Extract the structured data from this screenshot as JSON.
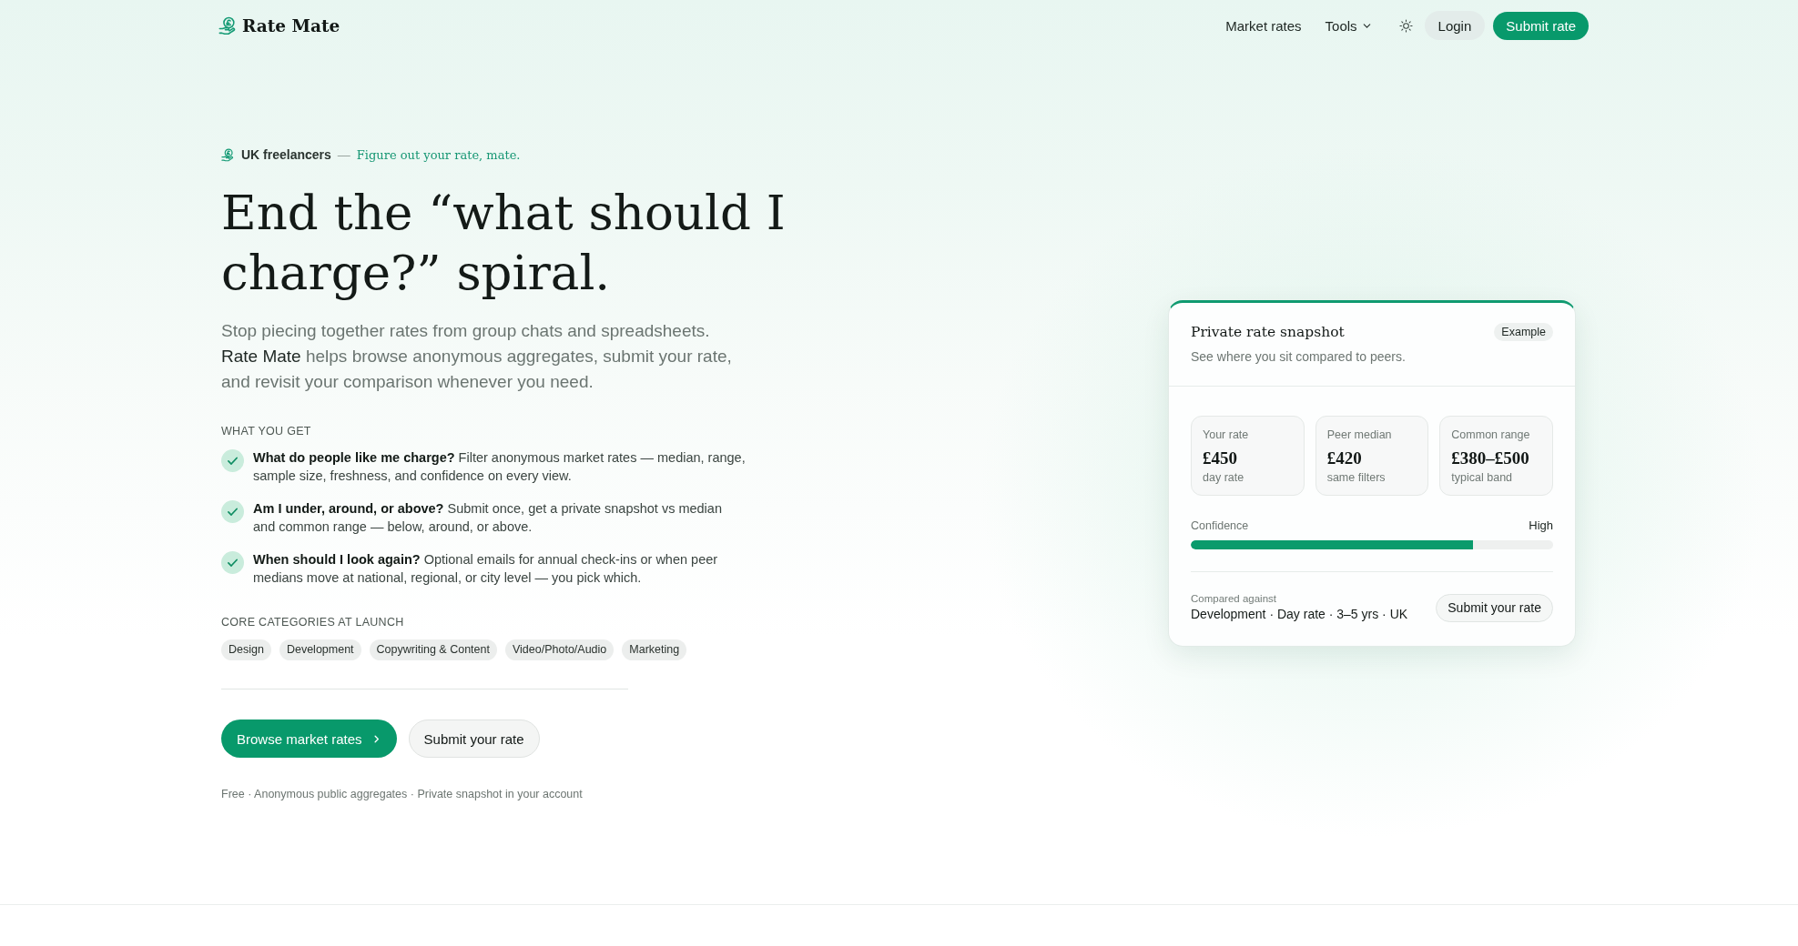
{
  "header": {
    "logo": "Rate Mate",
    "nav": [
      {
        "label": "Market rates",
        "kind": "link"
      },
      {
        "label": "Tools",
        "kind": "dropdown"
      }
    ],
    "login": "Login",
    "cta": "Submit rate"
  },
  "hero": {
    "eyebrow": {
      "audience": "UK freelancers",
      "separator": "—",
      "tagline": "Figure out your rate, mate."
    },
    "headline": "End the “what should I charge?” spiral.",
    "intro": "Stop piecing together rates from group chats and spreadsheets. **Rate Mate** helps browse anonymous aggregates, submit your rate, and revisit your comparison whenever you need.",
    "benefits": {
      "heading": "WHAT YOU GET",
      "items": [
        "**What do people like me charge?** Filter anonymous market rates — median, range, sample size, freshness, and confidence on every view.",
        "**Am I under, around, or above?** Submit once, get a private snapshot vs median and common range — below, around, or above.",
        "**When should I look again?** Optional emails for annual check-ins or when peer medians move at national, regional, or city level — you pick which."
      ]
    },
    "categories": {
      "heading": "CORE CATEGORIES AT LAUNCH",
      "items": [
        "Design",
        "Development",
        "Copywriting & Content",
        "Video/Photo/Audio",
        "Marketing"
      ]
    },
    "actions": [
      {
        "label": "Browse market rates",
        "kind": "primary"
      },
      {
        "label": "Submit your rate",
        "kind": "secondary"
      }
    ],
    "footnote": "Free · Anonymous public aggregates · Private snapshot in your account"
  },
  "snapshot": {
    "title": "Private rate snapshot",
    "badge": "Example",
    "subtitle": "See where you sit compared to peers.",
    "stats": [
      {
        "label": "Your rate",
        "value": "£450",
        "note": "day rate"
      },
      {
        "label": "Peer median",
        "value": "£420",
        "note": "same filters"
      },
      {
        "label": "Common range",
        "value": "£380–£500",
        "note": "typical band"
      }
    ],
    "confidence": {
      "label": "Confidence",
      "reading": "High",
      "level": 0.78
    },
    "comparison": {
      "label": "Compared against",
      "value": "Development · Day rate · 3–5 yrs · UK"
    },
    "button": "Submit your rate"
  }
}
